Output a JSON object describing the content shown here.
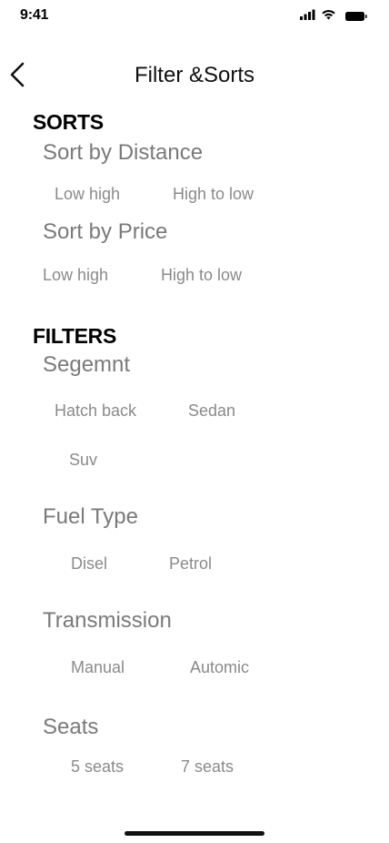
{
  "status_bar": {
    "time": "9:41",
    "icons": [
      "signal-icon",
      "wifi-icon",
      "battery-icon"
    ]
  },
  "header": {
    "title": "Filter &Sorts",
    "back_icon": "chevron-left-icon"
  },
  "sorts": {
    "title": "SORTS",
    "distance": {
      "title": "Sort by Distance",
      "options": [
        "Low high",
        "High to low"
      ]
    },
    "price": {
      "title": "Sort by Price",
      "options": [
        "Low high",
        "High to low"
      ]
    }
  },
  "filters": {
    "title": "FILTERS",
    "segment": {
      "title": "Segemnt",
      "options": [
        "Hatch back",
        "Sedan",
        "Suv"
      ]
    },
    "fuel": {
      "title": "Fuel Type",
      "options": [
        "Disel",
        "Petrol"
      ]
    },
    "transmission": {
      "title": "Transmission",
      "options": [
        "Manual",
        "Automic"
      ]
    },
    "seats": {
      "title": "Seats",
      "options": [
        "5 seats",
        "7 seats"
      ]
    }
  }
}
